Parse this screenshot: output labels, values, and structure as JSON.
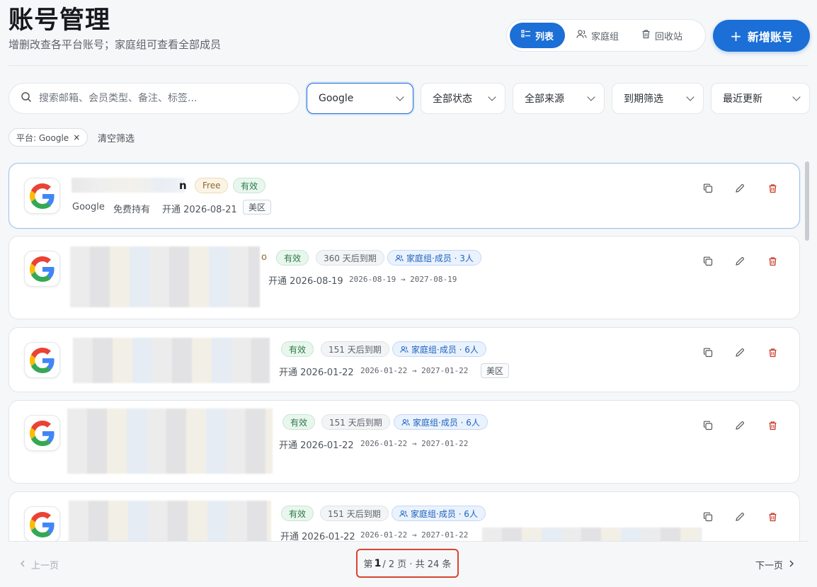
{
  "header": {
    "title": "账号管理",
    "subtitle": "增删改查各平台账号；家庭组可查看全部成员",
    "views": [
      {
        "label": "列表",
        "active": true
      },
      {
        "label": "家庭组",
        "active": false
      },
      {
        "label": "回收站",
        "active": false
      }
    ],
    "add_label": "新增账号"
  },
  "filters": {
    "search_placeholder": "搜索邮箱、会员类型、备注、标签...",
    "platform": "Google",
    "status": "全部状态",
    "source": "全部来源",
    "expiry": "到期筛选",
    "sort": "最近更新"
  },
  "active_chip": "平台: Google",
  "chip_remove": "×",
  "clear_label": "清空筛选",
  "accounts": [
    {
      "email_tail": "n",
      "tags": {
        "plan": "Free",
        "status": "有效"
      },
      "platform": "Google",
      "plan_desc": "免费持有",
      "opened": "开通 2026-08-21",
      "region": "美区"
    },
    {
      "plan_tail": "o",
      "tags": {
        "status": "有效",
        "days": "360 天后到期",
        "family": "家庭组·成员 · 3人"
      },
      "opened": "开通 2026-08-19",
      "range": "2026-08-19 → 2027-08-19"
    },
    {
      "tags": {
        "status": "有效",
        "days": "151 天后到期",
        "family": "家庭组·成员 · 6人"
      },
      "opened": "开通 2026-01-22",
      "range": "2026-01-22 → 2027-01-22",
      "region": "美区"
    },
    {
      "tags": {
        "status": "有效",
        "days": "151 天后到期",
        "family": "家庭组·成员 · 6人"
      },
      "opened": "开通 2026-01-22",
      "range": "2026-01-22 → 2027-01-22"
    },
    {
      "tags": {
        "status": "有效",
        "days": "151 天后到期",
        "family": "家庭组·成员 · 6人"
      },
      "opened": "开通 2026-01-22",
      "range": "2026-01-22 → 2027-01-22"
    }
  ],
  "pagination": {
    "prev": "上一页",
    "next": "下一页",
    "prefix": "第",
    "current": "1",
    "rest": "/ 2 页 · 共 24 条"
  },
  "colors": {
    "accent": "#1b6fd6",
    "highlight": "#d9452f"
  }
}
